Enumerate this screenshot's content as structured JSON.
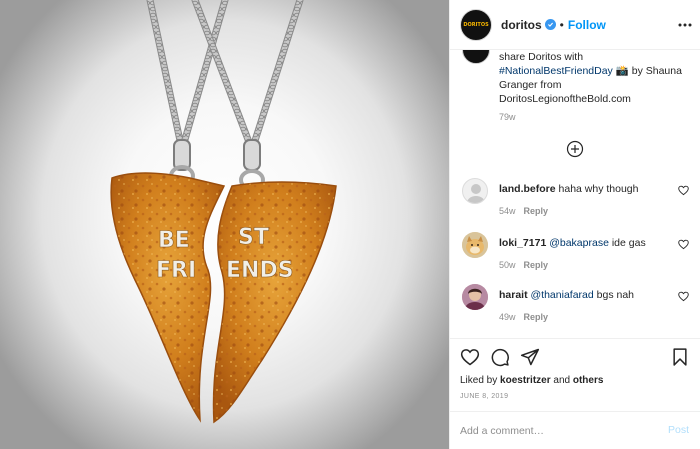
{
  "photo": {
    "necklace_left_text": [
      "BE",
      "FRI"
    ],
    "necklace_right_text": [
      "ST",
      "ENDS"
    ]
  },
  "header": {
    "avatar_label": "DORITOS",
    "username": "doritos",
    "separator": "•",
    "follow_label": "Follow"
  },
  "caption": {
    "text_start": "share Doritos with ",
    "hashtag": "#NationalBestFriendDay",
    "emoji": "📸",
    "text_mid": " by Shauna Granger from ",
    "mention": "DoritosLegionoftheBold.com",
    "time": "79w"
  },
  "comments": [
    {
      "user": "land.before",
      "mention": "",
      "text": " haha why though",
      "time": "54w",
      "reply_label": "Reply"
    },
    {
      "user": "loki_7171",
      "mention": "@bakaprase",
      "text": " ide gas",
      "time": "50w",
      "reply_label": "Reply"
    },
    {
      "user": "harait",
      "mention": "@thaniafarad",
      "text": " bgs nah",
      "time": "49w",
      "reply_label": "Reply"
    }
  ],
  "actions": {
    "likes_prefix": "Liked by ",
    "likes_user": "koestritzer",
    "likes_and": " and ",
    "likes_others": "others",
    "date": "JUNE 8, 2019"
  },
  "add_comment": {
    "placeholder": "Add a comment…",
    "post_label": "Post"
  },
  "colors": {
    "link": "#0095f6",
    "mention": "#00376b",
    "muted": "#8e8e8e",
    "chip": "#d8861e"
  }
}
